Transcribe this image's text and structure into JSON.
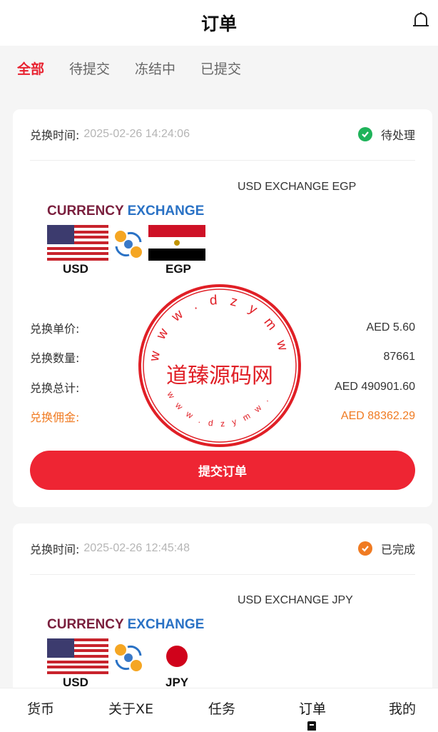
{
  "header": {
    "title": "订单"
  },
  "tabs": [
    {
      "label": "全部",
      "active": true
    },
    {
      "label": "待提交",
      "active": false
    },
    {
      "label": "冻结中",
      "active": false
    },
    {
      "label": "已提交",
      "active": false
    }
  ],
  "orders": [
    {
      "time_label": "兑换时间:",
      "time": "2025-02-26 14:24:06",
      "status": "待处理",
      "status_icon": "green-check-icon",
      "product": "USD EXCHANGE EGP",
      "logo": {
        "left": "CURRENCY",
        "right": "EXCHANGE",
        "from": "USD",
        "to": "EGP"
      },
      "rows": [
        {
          "label": "兑换单价:",
          "value": "AED 5.60"
        },
        {
          "label": "兑换数量:",
          "value": "87661"
        },
        {
          "label": "兑换总计:",
          "value": "AED 490901.60"
        },
        {
          "label": "兑换佣金:",
          "value": "AED 88362.29"
        }
      ],
      "button": "提交订单"
    },
    {
      "time_label": "兑换时间:",
      "time": "2025-02-26 12:45:48",
      "status": "已完成",
      "status_icon": "orange-check-icon",
      "product": "USD EXCHANGE JPY",
      "logo": {
        "left": "CURRENCY",
        "right": "EXCHANGE",
        "from": "USD",
        "to": "JPY"
      }
    }
  ],
  "watermark": {
    "text": "道臻源码网",
    "ring_text": "www.dzym.com"
  },
  "nav": [
    {
      "label": "货币"
    },
    {
      "label": "关于XE"
    },
    {
      "label": "任务"
    },
    {
      "label": "订单",
      "active": true
    },
    {
      "label": "我的"
    }
  ],
  "colors": {
    "accent": "#ee2533",
    "commission": "#f07b22",
    "pending": "#1fb35a",
    "done": "#f07b22"
  }
}
